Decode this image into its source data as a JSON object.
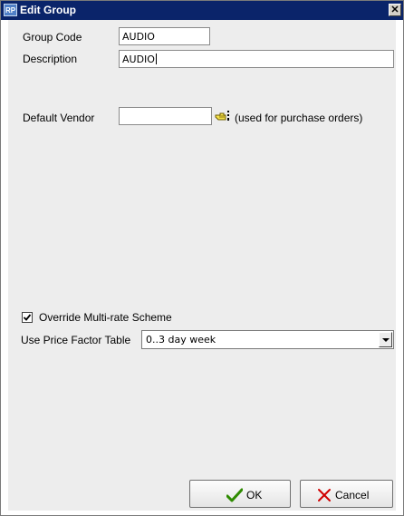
{
  "window": {
    "title": "Edit Group",
    "app_icon_text": "RP",
    "close_glyph": "✕"
  },
  "form": {
    "group_code": {
      "label": "Group Code",
      "value": "AUDIO"
    },
    "description": {
      "label": "Description",
      "value": "AUDIO"
    },
    "default_vendor": {
      "label": "Default Vendor",
      "value": "",
      "hint": "(used for purchase orders)",
      "lookup_icon": "pointing-hand-lookup-icon"
    },
    "override_multirate": {
      "label": "Override Multi-rate Scheme",
      "checked": true
    },
    "price_factor_table": {
      "label": "Use Price Factor Table",
      "selected": "0..3 day week"
    }
  },
  "buttons": {
    "ok": {
      "label": "OK",
      "icon": "checkmark-icon",
      "icon_color": "#2e8b00"
    },
    "cancel": {
      "label": "Cancel",
      "icon": "x-icon",
      "icon_color": "#d00000"
    }
  },
  "colors": {
    "titlebar": "#0a246a",
    "client_background": "#ededed"
  }
}
